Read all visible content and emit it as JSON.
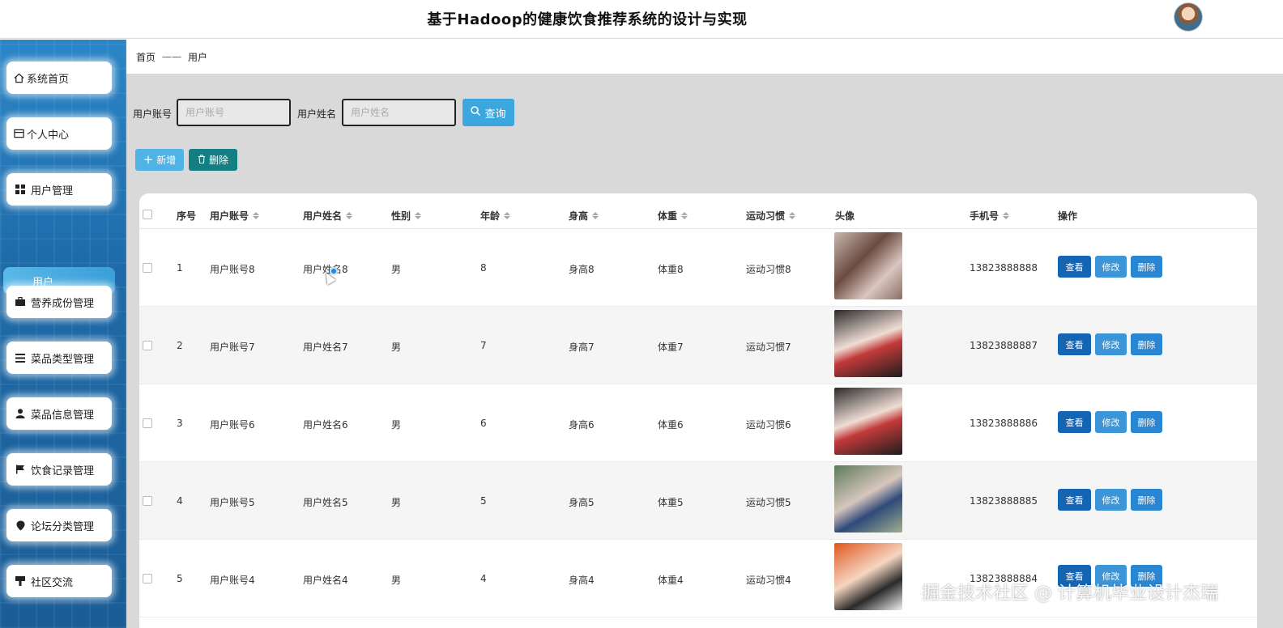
{
  "header": {
    "title": "基于Hadoop的健康饮食推荐系统的设计与实现"
  },
  "sidebar": {
    "items": [
      {
        "label": "系统首页",
        "icon": "home-icon"
      },
      {
        "label": "个人中心",
        "icon": "card-icon"
      },
      {
        "label": "用户管理",
        "icon": "grid-icon"
      },
      {
        "label": "用户",
        "icon": ""
      },
      {
        "label": "营养成份管理",
        "icon": "briefcase-icon"
      },
      {
        "label": "菜品类型管理",
        "icon": "list-icon"
      },
      {
        "label": "菜品信息管理",
        "icon": "user-icon"
      },
      {
        "label": "饮食记录管理",
        "icon": "flag-icon"
      },
      {
        "label": "论坛分类管理",
        "icon": "pin-icon"
      },
      {
        "label": "社区交流",
        "icon": "podium-icon"
      }
    ]
  },
  "breadcrumb": {
    "home": "首页",
    "separator": "——",
    "current": "用户"
  },
  "search": {
    "account_label": "用户账号",
    "account_placeholder": "用户账号",
    "name_label": "用户姓名",
    "name_placeholder": "用户姓名",
    "query_label": "查询"
  },
  "actions": {
    "add_label": "新增",
    "delete_label": "删除"
  },
  "table": {
    "columns": [
      "序号",
      "用户账号",
      "用户姓名",
      "性别",
      "年龄",
      "身高",
      "体重",
      "运动习惯",
      "头像",
      "手机号",
      "操作"
    ],
    "rows": [
      {
        "index": "1",
        "account": "用户账号8",
        "name": "用户姓名8",
        "gender": "男",
        "age": "8",
        "height": "身高8",
        "weight": "体重8",
        "habit": "运动习惯8",
        "phone": "13823888888"
      },
      {
        "index": "2",
        "account": "用户账号7",
        "name": "用户姓名7",
        "gender": "男",
        "age": "7",
        "height": "身高7",
        "weight": "体重7",
        "habit": "运动习惯7",
        "phone": "13823888887"
      },
      {
        "index": "3",
        "account": "用户账号6",
        "name": "用户姓名6",
        "gender": "男",
        "age": "6",
        "height": "身高6",
        "weight": "体重6",
        "habit": "运动习惯6",
        "phone": "13823888886"
      },
      {
        "index": "4",
        "account": "用户账号5",
        "name": "用户姓名5",
        "gender": "男",
        "age": "5",
        "height": "身高5",
        "weight": "体重5",
        "habit": "运动习惯5",
        "phone": "13823888885"
      },
      {
        "index": "5",
        "account": "用户账号4",
        "name": "用户姓名4",
        "gender": "男",
        "age": "4",
        "height": "身高4",
        "weight": "体重4",
        "habit": "运动习惯4",
        "phone": "13823888884"
      }
    ],
    "op_labels": {
      "view": "查看",
      "edit": "修改",
      "delete": "删除"
    }
  },
  "watermark": "掘金技术社区 @ 计算机毕业设计杰瑞",
  "colors": {
    "primary": "#1565b5",
    "accent": "#3ca7df",
    "teal": "#137f82",
    "sidebar": "#1e6aa8"
  }
}
